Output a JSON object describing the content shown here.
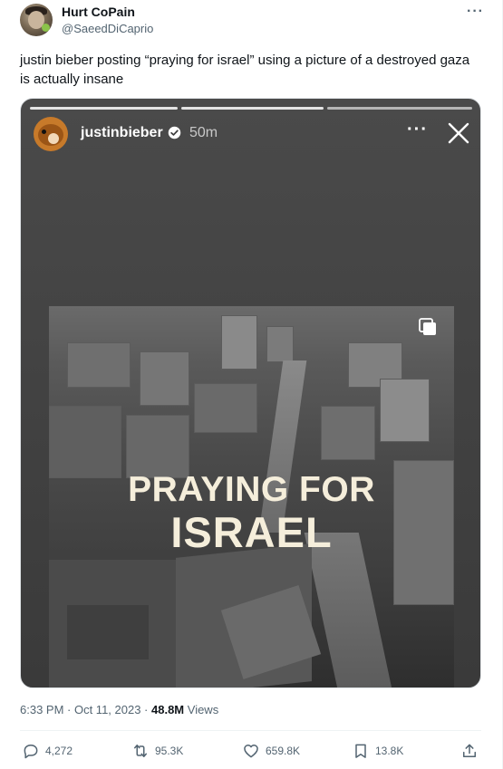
{
  "author": {
    "display_name": "Hurt CoPain",
    "handle": "@SaeedDiCaprio"
  },
  "tweet": {
    "text": "justin bieber posting “praying for israel” using a picture of a destroyed gaza is actually insane",
    "timestamp": "6:33 PM · Oct 11, 2023 · ",
    "views_count": "48.8M",
    "views_label": " Views"
  },
  "story": {
    "username": "justinbieber",
    "time_ago": "50m",
    "overlay_line1": "PRAYING FOR",
    "overlay_line2": "ISRAEL"
  },
  "actions": {
    "replies": "4,272",
    "retweets": "95.3K",
    "likes": "659.8K",
    "bookmarks": "13.8K"
  },
  "colors": {
    "text_primary": "#0f1419",
    "text_secondary": "#536471",
    "overlay_text": "#f5eedb"
  }
}
